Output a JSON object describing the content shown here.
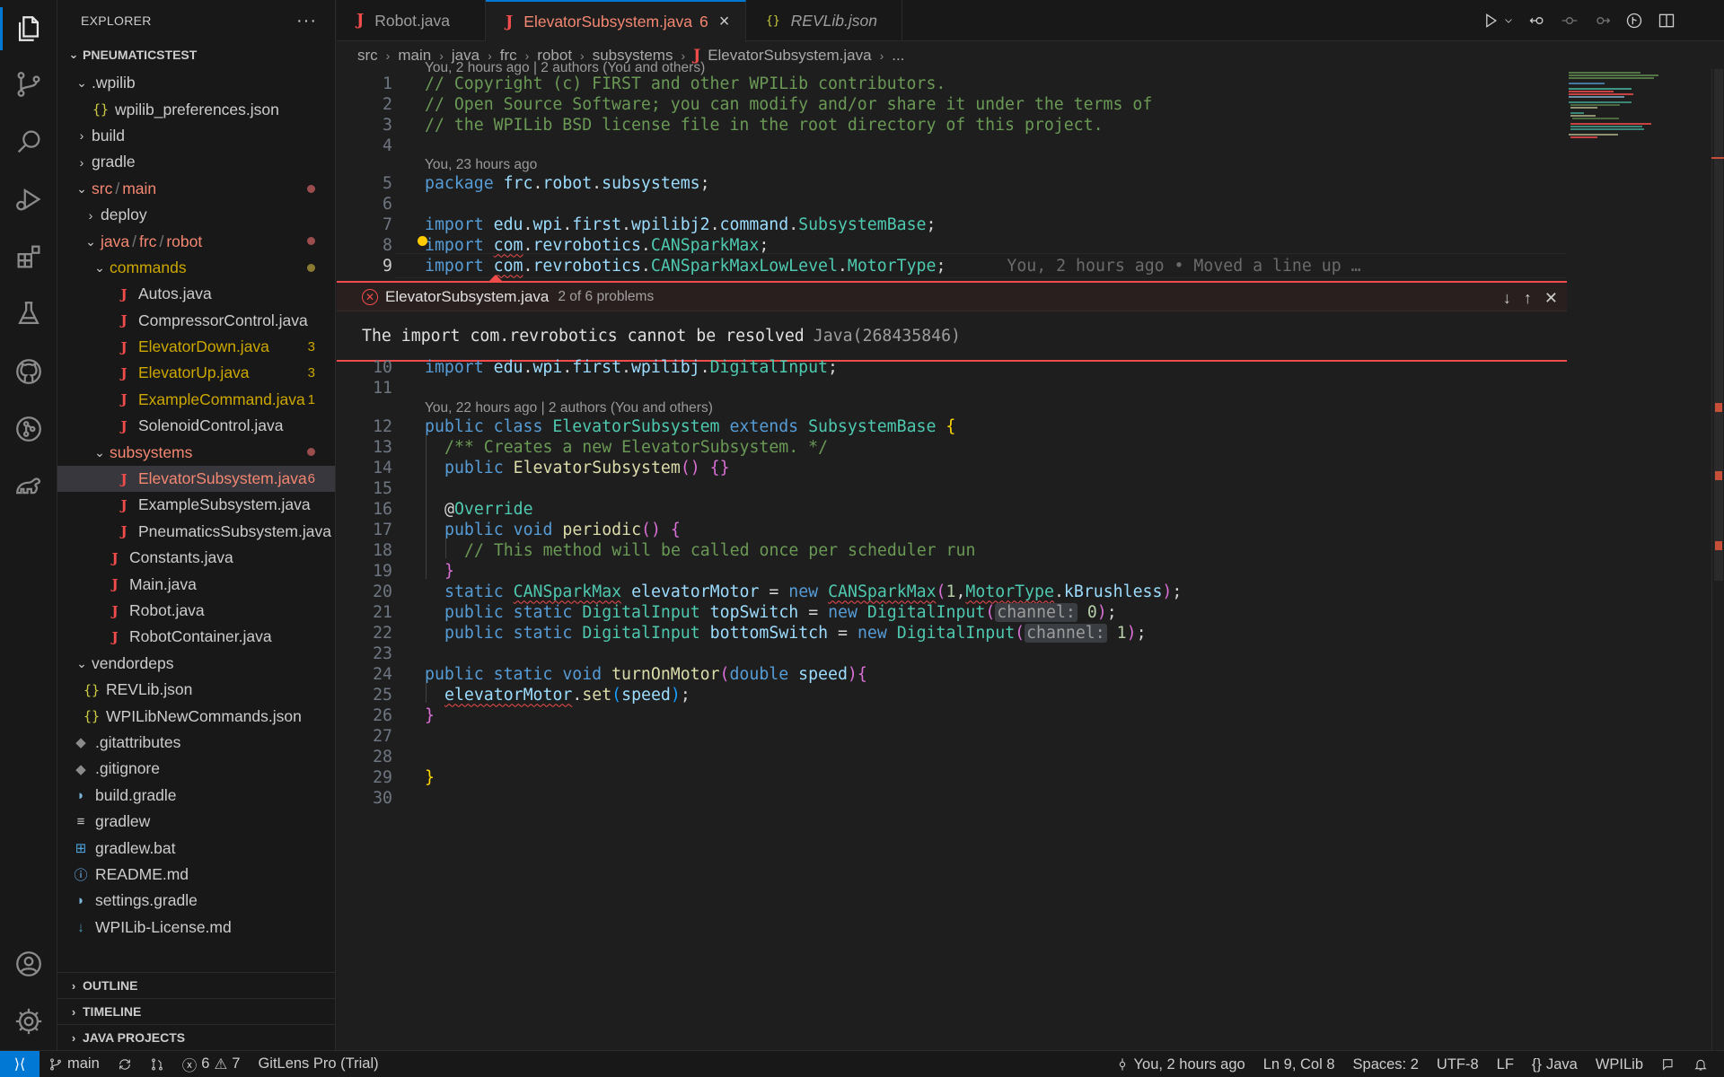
{
  "sidebar": {
    "title": "EXPLORER",
    "more_label": "···",
    "workspace": "PNEUMATICSTEST",
    "items": [
      {
        "label": ".wpilib"
      },
      {
        "label": "wpilib_preferences.json"
      },
      {
        "label": "build"
      },
      {
        "label": "gradle"
      },
      {
        "label_parts": [
          "src",
          "main"
        ]
      },
      {
        "label": "deploy"
      },
      {
        "label_parts": [
          "java",
          "frc",
          "robot"
        ]
      },
      {
        "label": "commands"
      },
      {
        "label": "Autos.java"
      },
      {
        "label": "CompressorControl.java"
      },
      {
        "label": "ElevatorDown.java",
        "badge": "3"
      },
      {
        "label": "ElevatorUp.java",
        "badge": "3"
      },
      {
        "label": "ExampleCommand.java",
        "badge": "1"
      },
      {
        "label": "SolenoidControl.java"
      },
      {
        "label": "subsystems"
      },
      {
        "label": "ElevatorSubsystem.java",
        "badge": "6"
      },
      {
        "label": "ExampleSubsystem.java"
      },
      {
        "label": "PneumaticsSubsystem.java"
      },
      {
        "label": "Constants.java"
      },
      {
        "label": "Main.java"
      },
      {
        "label": "Robot.java"
      },
      {
        "label": "RobotContainer.java"
      },
      {
        "label": "vendordeps"
      },
      {
        "label": "REVLib.json"
      },
      {
        "label": "WPILibNewCommands.json"
      },
      {
        "label": ".gitattributes"
      },
      {
        "label": ".gitignore"
      },
      {
        "label": "build.gradle"
      },
      {
        "label": "gradlew"
      },
      {
        "label": "gradlew.bat"
      },
      {
        "label": "README.md"
      },
      {
        "label": "settings.gradle"
      },
      {
        "label": "WPILib-License.md"
      }
    ],
    "outline": "OUTLINE",
    "timeline": "TIMELINE",
    "java_projects": "JAVA PROJECTS"
  },
  "tabs": [
    {
      "label": "Robot.java"
    },
    {
      "label": "ElevatorSubsystem.java",
      "count": "6"
    },
    {
      "label": "REVLib.json"
    }
  ],
  "breadcrumb": [
    "src",
    "main",
    "java",
    "frc",
    "robot",
    "subsystems",
    "ElevatorSubsystem.java",
    "..."
  ],
  "editor": {
    "codelens": {
      "top": "You, 2 hours ago | 2 authors (You and others)",
      "package": "You, 23 hours ago",
      "class": "You, 22 hours ago | 2 authors (You and others)"
    },
    "line_numbers": [
      "1",
      "2",
      "3",
      "4",
      "5",
      "6",
      "7",
      "8",
      "9",
      "10",
      "11",
      "12",
      "13",
      "14",
      "15",
      "16",
      "17",
      "18",
      "19",
      "20",
      "21",
      "22",
      "23",
      "24",
      "25",
      "26",
      "27",
      "28",
      "29",
      "30"
    ],
    "lines": {
      "l1": "// Copyright (c) FIRST and other WPILib contributors.",
      "l2": "// Open Source Software; you can modify and/or share it under the terms of",
      "l3": "// the WPILib BSD license file in the root directory of this project.",
      "l9_blame": "You, 2 hours ago • Moved a line up …",
      "l13": "/** Creates a new ElevatorSubsystem. */",
      "l18": "// This method will be called once per scheduler run"
    }
  },
  "peek": {
    "file": "ElevatorSubsystem.java",
    "count": "2 of 6 problems",
    "message": "The import com.revrobotics cannot be resolved",
    "source": "Java(268435846)"
  },
  "status": {
    "branch": "main",
    "errors": "6",
    "warnings": "7",
    "gitlens": "GitLens Pro (Trial)",
    "blame": "You, 2 hours ago",
    "position": "Ln 9, Col 8",
    "spaces": "Spaces: 2",
    "encoding": "UTF-8",
    "eol": "LF",
    "language": "Java",
    "wpilib": "WPILib"
  },
  "colors": {
    "accent": "#0078d4",
    "error": "#f14c4c",
    "warning": "#cca700"
  }
}
